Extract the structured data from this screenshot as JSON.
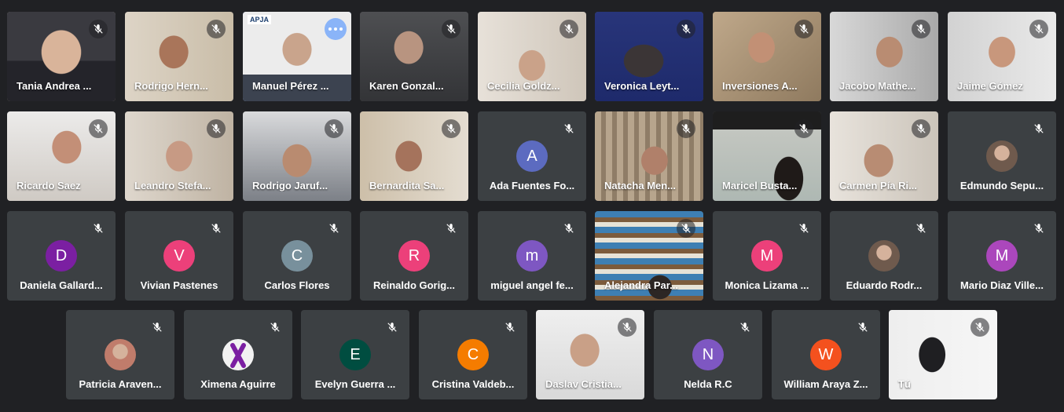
{
  "participants": [
    {
      "name": "Tania Andrea ...",
      "icon": "mic-off-icon"
    },
    {
      "name": "Rodrigo Hern...",
      "icon": "mic-off-icon"
    },
    {
      "name": "Manuel Pérez ...",
      "badge": "APJA",
      "more_icon": "more-options-icon",
      "speaking_color": "#8ab4f8"
    },
    {
      "name": "Karen Gonzal...",
      "icon": "mic-off-icon"
    },
    {
      "name": "Cecilia Goldz...",
      "icon": "mic-off-icon"
    },
    {
      "name": "Veronica Leyt...",
      "icon": "mic-off-icon"
    },
    {
      "name": "Inversiones A...",
      "icon": "mic-off-icon"
    },
    {
      "name": "Jacobo Mathe...",
      "icon": "mic-off-icon"
    },
    {
      "name": "Jaime Gómez",
      "icon": "mic-off-icon"
    },
    {
      "name": "Ricardo Saez",
      "icon": "mic-off-icon"
    },
    {
      "name": "Leandro Stefa...",
      "icon": "mic-off-icon"
    },
    {
      "name": "Rodrigo Jaruf...",
      "icon": "mic-off-icon"
    },
    {
      "name": "Bernardita Sa...",
      "icon": "mic-off-icon"
    },
    {
      "name": "Ada Fuentes Fo...",
      "initial": "A",
      "color": "#5c6bc0",
      "icon": "mic-off-icon"
    },
    {
      "name": "Natacha Men...",
      "icon": "mic-off-icon"
    },
    {
      "name": "Maricel Busta...",
      "icon": "mic-off-icon"
    },
    {
      "name": "Carmen Pía Ri...",
      "icon": "mic-off-icon"
    },
    {
      "name": "Edmundo Sepu...",
      "photo": true,
      "icon": "mic-off-icon"
    },
    {
      "name": "Daniela Gallard...",
      "initial": "D",
      "color": "#7b1fa2",
      "icon": "mic-off-icon"
    },
    {
      "name": "Vivian Pastenes",
      "initial": "V",
      "color": "#ec407a",
      "icon": "mic-off-icon"
    },
    {
      "name": "Carlos Flores",
      "initial": "C",
      "color": "#78909c",
      "icon": "mic-off-icon"
    },
    {
      "name": "Reinaldo Gorig...",
      "initial": "R",
      "color": "#ec407a",
      "icon": "mic-off-icon"
    },
    {
      "name": "miguel angel fe...",
      "initial": "m",
      "color": "#7e57c2",
      "icon": "mic-off-icon"
    },
    {
      "name": "Alejandra Par...",
      "icon": "mic-off-icon"
    },
    {
      "name": "Monica Lizama ...",
      "initial": "M",
      "color": "#ec407a",
      "icon": "mic-off-icon"
    },
    {
      "name": "Eduardo Rodr...",
      "photo": true,
      "icon": "mic-off-icon"
    },
    {
      "name": "Mario Diaz Ville...",
      "initial": "M",
      "color": "#ab47bc",
      "icon": "mic-off-icon"
    },
    {
      "name": "Patricia Araven...",
      "photo": true,
      "icon": "mic-off-icon"
    },
    {
      "name": "Ximena Aguirre",
      "photo": true,
      "ribbon": true,
      "icon": "mic-off-icon"
    },
    {
      "name": "Evelyn Guerra ...",
      "initial": "E",
      "color": "#004d40",
      "icon": "mic-off-icon"
    },
    {
      "name": "Cristina Valdeb...",
      "initial": "C",
      "color": "#f57c00",
      "icon": "mic-off-icon"
    },
    {
      "name": "Daslav Cristia...",
      "icon": "mic-off-icon"
    },
    {
      "name": "Nelda R.C",
      "initial": "N",
      "color": "#7e57c2",
      "icon": "mic-off-icon"
    },
    {
      "name": "William Araya Z...",
      "initial": "W",
      "color": "#f4511e",
      "icon": "mic-off-icon"
    },
    {
      "name": "Tú",
      "icon": "mic-off-icon"
    }
  ]
}
